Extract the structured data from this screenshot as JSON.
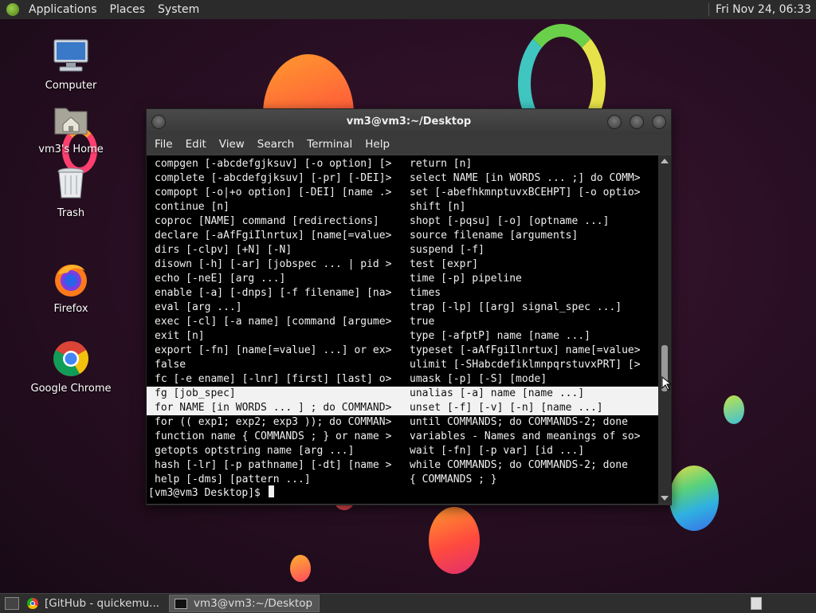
{
  "top_panel": {
    "menus": [
      "Applications",
      "Places",
      "System"
    ],
    "clock": "Fri Nov 24, 06:33"
  },
  "desktop_icons": [
    {
      "label": "Computer",
      "icon": "computer-icon"
    },
    {
      "label": "vm3's Home",
      "icon": "home-folder-icon"
    },
    {
      "label": "Trash",
      "icon": "trash-icon"
    },
    {
      "label": "Firefox",
      "icon": "firefox-icon"
    },
    {
      "label": "Google Chrome",
      "icon": "chrome-icon"
    }
  ],
  "window": {
    "title": "vm3@vm3:~/Desktop",
    "menu": [
      "File",
      "Edit",
      "View",
      "Search",
      "Terminal",
      "Help"
    ]
  },
  "terminal": {
    "rows": [
      [
        "compgen [-abcdefgjksuv] [-o option] [>",
        "return [n]"
      ],
      [
        "complete [-abcdefgjksuv] [-pr] [-DEI]>",
        "select NAME [in WORDS ... ;] do COMM>"
      ],
      [
        "compopt [-o|+o option] [-DEI] [name .>",
        "set [-abefhkmnptuvxBCEHPT] [-o optio>"
      ],
      [
        "continue [n]",
        "shift [n]"
      ],
      [
        "coproc [NAME] command [redirections]",
        "shopt [-pqsu] [-o] [optname ...]"
      ],
      [
        "declare [-aAfFgiIlnrtux] [name[=value>",
        "source filename [arguments]"
      ],
      [
        "dirs [-clpv] [+N] [-N]",
        "suspend [-f]"
      ],
      [
        "disown [-h] [-ar] [jobspec ... | pid >",
        "test [expr]"
      ],
      [
        "echo [-neE] [arg ...]",
        "time [-p] pipeline"
      ],
      [
        "enable [-a] [-dnps] [-f filename] [na>",
        "times"
      ],
      [
        "eval [arg ...]",
        "trap [-lp] [[arg] signal_spec ...]"
      ],
      [
        "exec [-cl] [-a name] [command [argume>",
        "true"
      ],
      [
        "exit [n]",
        "type [-afptP] name [name ...]"
      ],
      [
        "export [-fn] [name[=value] ...] or ex>",
        "typeset [-aAfFgiIlnrtux] name[=value>"
      ],
      [
        "false",
        "ulimit [-SHabcdefiklmnpqrstuvxPRT] [>"
      ],
      [
        "fc [-e ename] [-lnr] [first] [last] o>",
        "umask [-p] [-S] [mode]"
      ],
      [
        "fg [job_spec]",
        "unalias [-a] name [name ...]"
      ],
      [
        "for NAME [in WORDS ... ] ; do COMMAND>",
        "unset [-f] [-v] [-n] [name ...]"
      ],
      [
        "for (( exp1; exp2; exp3 )); do COMMAN>",
        "until COMMANDS; do COMMANDS-2; done"
      ],
      [
        "function name { COMMANDS ; } or name >",
        "variables - Names and meanings of so>"
      ],
      [
        "getopts optstring name [arg ...]",
        "wait [-fn] [-p var] [id ...]"
      ],
      [
        "hash [-lr] [-p pathname] [-dt] [name >",
        "while COMMANDS; do COMMANDS-2; done"
      ],
      [
        "help [-dms] [pattern ...]",
        "{ COMMANDS ; }"
      ]
    ],
    "highlighted_rows": [
      16,
      17
    ],
    "prompt": "[vm3@vm3 Desktop]$"
  },
  "taskbar": {
    "tasks": [
      {
        "label": "[GitHub - quickemu...",
        "icon": "chrome-icon"
      },
      {
        "label": "vm3@vm3:~/Desktop",
        "icon": "terminal-icon"
      }
    ]
  },
  "colors": {
    "terminal_bg": "#000000",
    "terminal_fg": "#f0f0f0",
    "selection_bg": "#f2f2f2",
    "panel_bg": "#2b2b2b"
  }
}
